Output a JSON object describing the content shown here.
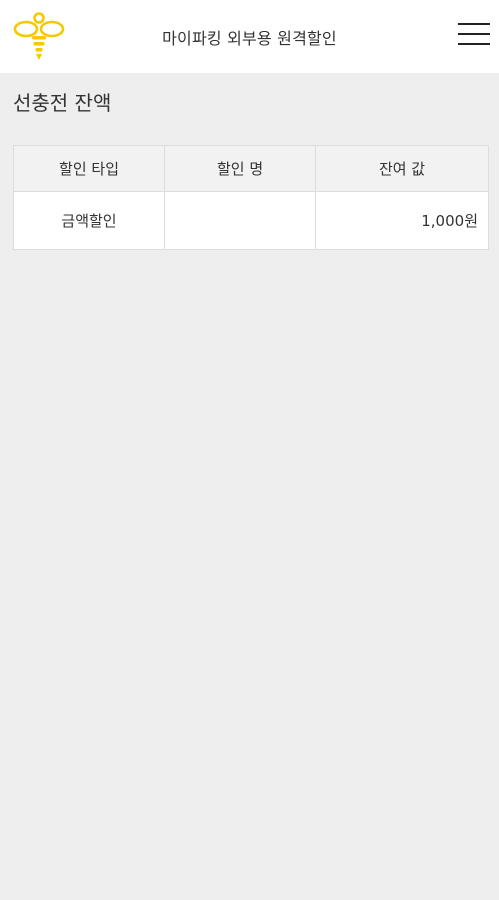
{
  "header": {
    "title": "마이파킹 외부용 원격할인",
    "logo_icon": "bee-logo-icon",
    "menu_icon": "hamburger-menu-icon",
    "accent_color": "#f5c800"
  },
  "main": {
    "section_title": "선충전 잔액",
    "table": {
      "columns": [
        "할인 타입",
        "할인 명",
        "잔여 값"
      ],
      "rows": [
        {
          "type": "금액할인",
          "name": "",
          "value": "1,000원"
        }
      ]
    }
  }
}
